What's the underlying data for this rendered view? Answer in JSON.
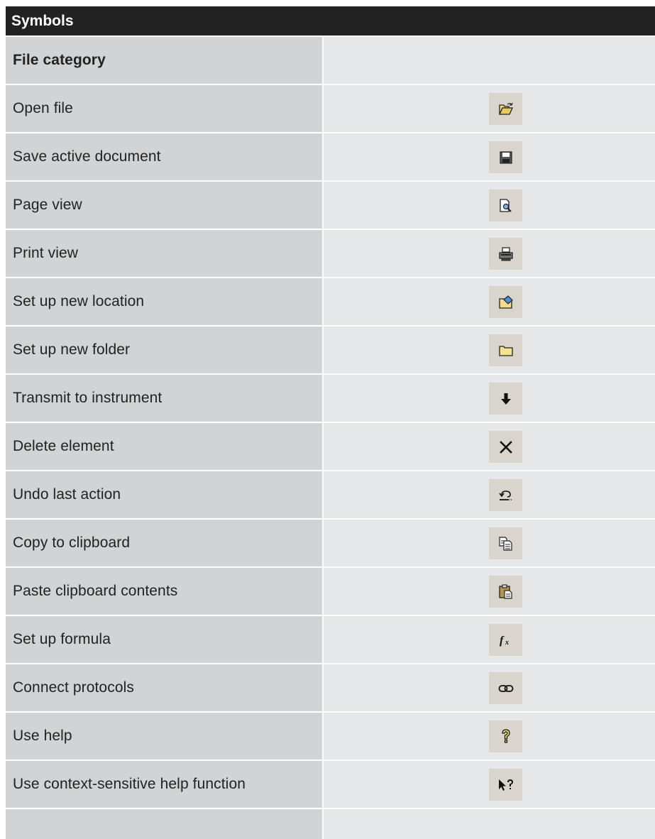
{
  "title": "Symbols",
  "category_header": "File category",
  "rows": [
    {
      "label": "Open file",
      "icon": "open-folder-icon"
    },
    {
      "label": "Save active document",
      "icon": "floppy-disk-icon"
    },
    {
      "label": "Page view",
      "icon": "page-magnifier-icon"
    },
    {
      "label": "Print view",
      "icon": "printer-icon"
    },
    {
      "label": "Set up new location",
      "icon": "new-location-icon"
    },
    {
      "label": "Set up new folder",
      "icon": "folder-icon"
    },
    {
      "label": "Transmit to instrument",
      "icon": "arrow-down-icon"
    },
    {
      "label": "Delete element",
      "icon": "delete-x-icon"
    },
    {
      "label": "Undo last action",
      "icon": "undo-icon"
    },
    {
      "label": "Copy to clipboard",
      "icon": "copy-icon"
    },
    {
      "label": "Paste clipboard contents",
      "icon": "paste-icon"
    },
    {
      "label": "Set up formula",
      "icon": "formula-fx-icon"
    },
    {
      "label": "Connect protocols",
      "icon": "link-icon"
    },
    {
      "label": "Use help",
      "icon": "help-question-icon"
    },
    {
      "label": "Use context-sensitive help function",
      "icon": "context-help-icon"
    }
  ],
  "colors": {
    "title_bg": "#222222",
    "label_cell": "#d1d3d4",
    "icon_cell": "#e6e7e8",
    "icon_button": "#d9d4cc"
  }
}
